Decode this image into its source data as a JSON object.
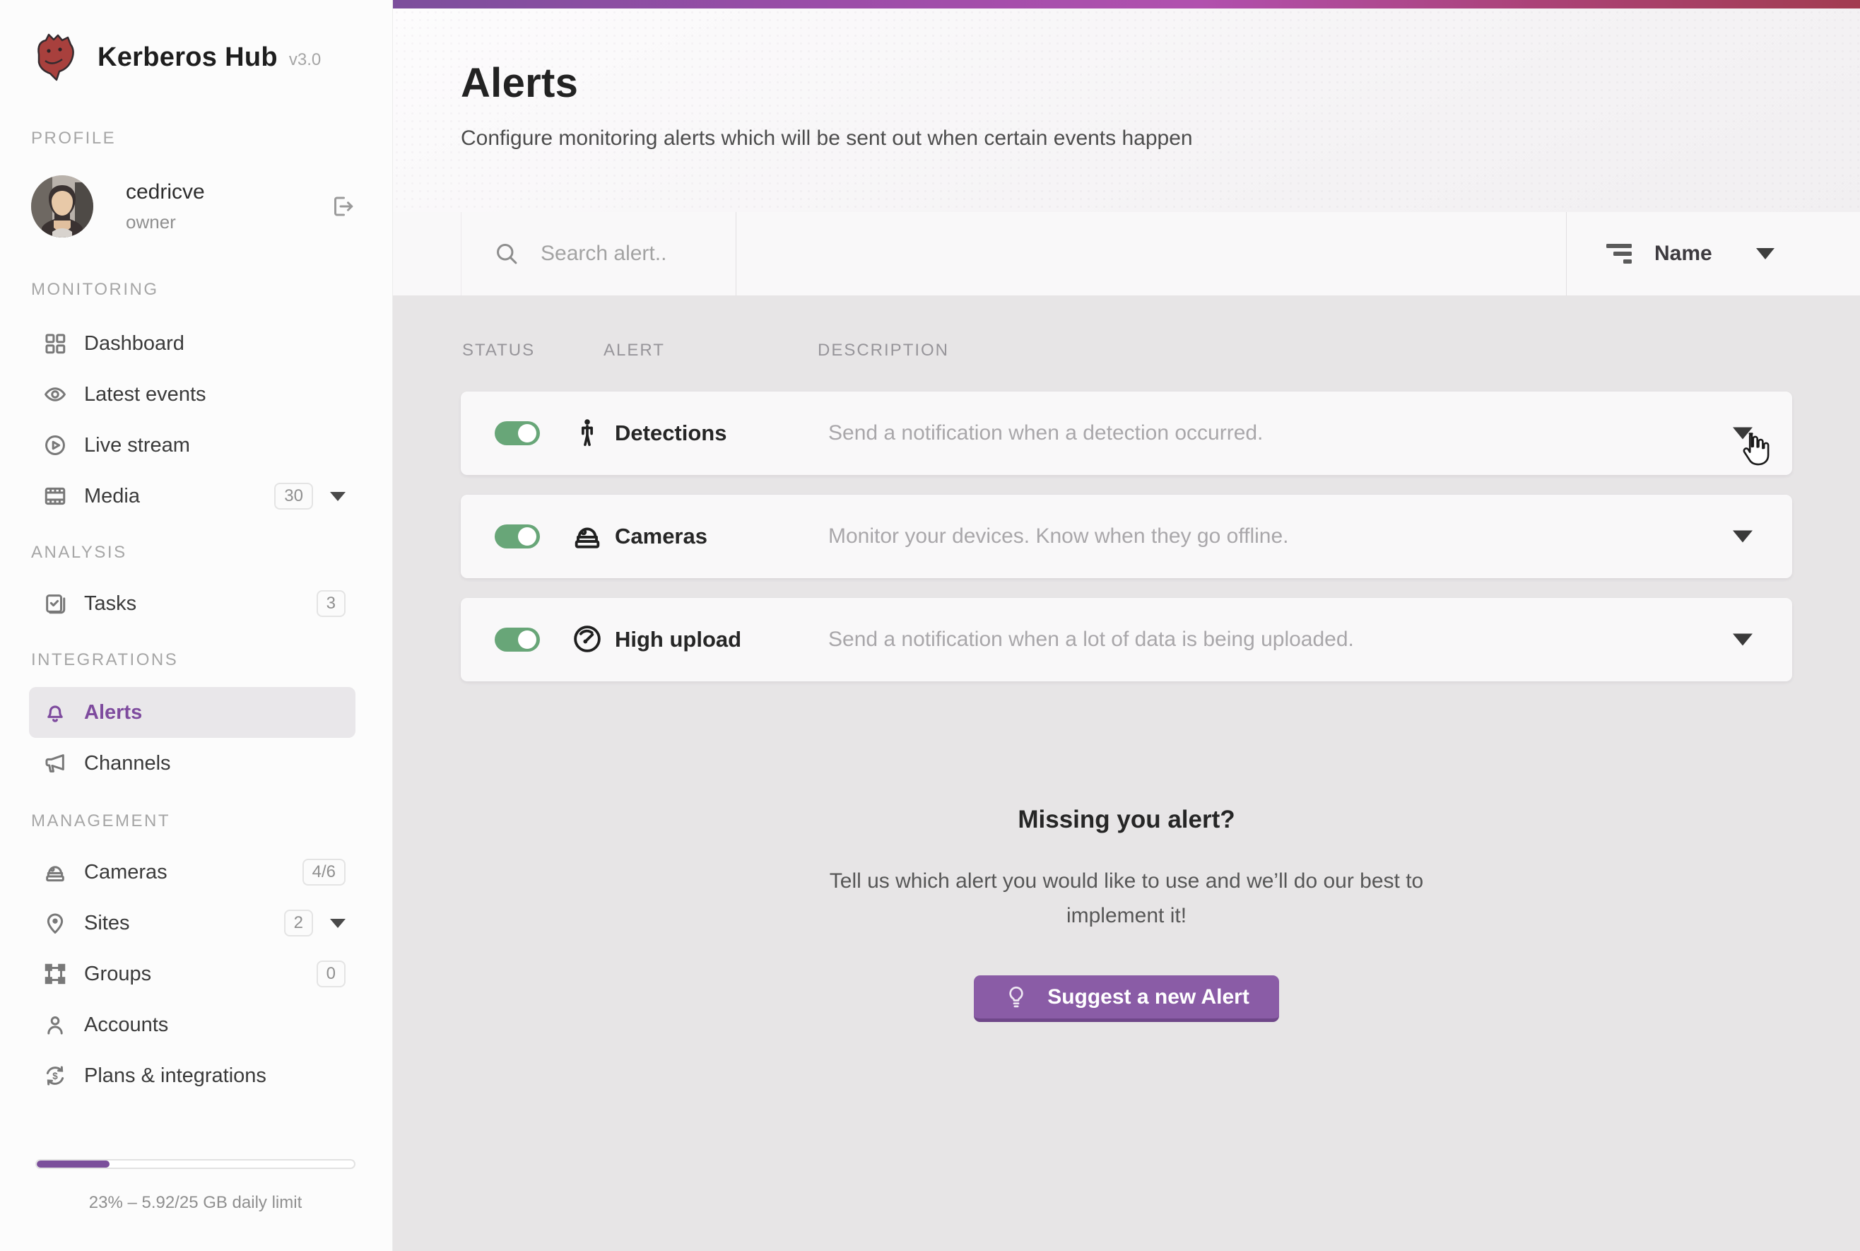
{
  "app": {
    "name": "Kerberos Hub",
    "version": "v3.0"
  },
  "profile": {
    "section_label": "PROFILE",
    "username": "cedricve",
    "role": "owner"
  },
  "sidebar": {
    "sections": [
      {
        "label": "MONITORING",
        "items": [
          {
            "label": "Dashboard",
            "icon": "dashboard-icon"
          },
          {
            "label": "Latest events",
            "icon": "eye-icon"
          },
          {
            "label": "Live stream",
            "icon": "play-circle-icon"
          },
          {
            "label": "Media",
            "icon": "film-icon",
            "badge": "30"
          }
        ]
      },
      {
        "label": "ANALYSIS",
        "items": [
          {
            "label": "Tasks",
            "icon": "task-check-icon",
            "badge": "3"
          }
        ]
      },
      {
        "label": "INTEGRATIONS",
        "items": [
          {
            "label": "Alerts",
            "icon": "bell-icon"
          },
          {
            "label": "Channels",
            "icon": "megaphone-icon"
          }
        ]
      },
      {
        "label": "MANAGEMENT",
        "items": [
          {
            "label": "Cameras",
            "icon": "dome-camera-icon",
            "badge": "4/6"
          },
          {
            "label": "Sites",
            "icon": "map-pin-icon",
            "badge": "2"
          },
          {
            "label": "Groups",
            "icon": "group-frame-icon",
            "badge": "0"
          },
          {
            "label": "Accounts",
            "icon": "person-icon"
          },
          {
            "label": "Plans & integrations",
            "icon": "dollar-refresh-icon"
          }
        ]
      }
    ],
    "usage": {
      "percent": 23,
      "label": "23% – 5.92/25 GB daily limit"
    }
  },
  "header": {
    "title": "Alerts",
    "subtitle": "Configure monitoring alerts which will be sent out when certain events happen"
  },
  "toolbar": {
    "search_placeholder": "Search alert..",
    "sort_label": "Name"
  },
  "table": {
    "headers": [
      "STATUS",
      "ALERT",
      "DESCRIPTION"
    ],
    "rows": [
      {
        "enabled": true,
        "name": "Detections",
        "icon": "walking-person-icon",
        "description": "Send a notification when a detection occurred."
      },
      {
        "enabled": true,
        "name": "Cameras",
        "icon": "dome-camera-icon",
        "description": "Monitor your devices. Know when they go offline."
      },
      {
        "enabled": true,
        "name": "High upload",
        "icon": "gauge-icon",
        "description": "Send a notification when a lot of data is being uploaded."
      }
    ]
  },
  "cta": {
    "heading": "Missing you alert?",
    "body_line1": "Tell us which alert you would like to use and we’ll do our best to",
    "body_line2": "implement it!",
    "button_label": "Suggest a new Alert"
  },
  "colors": {
    "accent_purple": "#7e4b9e",
    "toggle_green": "#68a678",
    "button_purple": "#8a5ca6",
    "gradient_start": "#7c4e9c",
    "gradient_mid": "#b150ae",
    "gradient_end": "#a23c50",
    "progress_purple": "#7b4f9b"
  }
}
